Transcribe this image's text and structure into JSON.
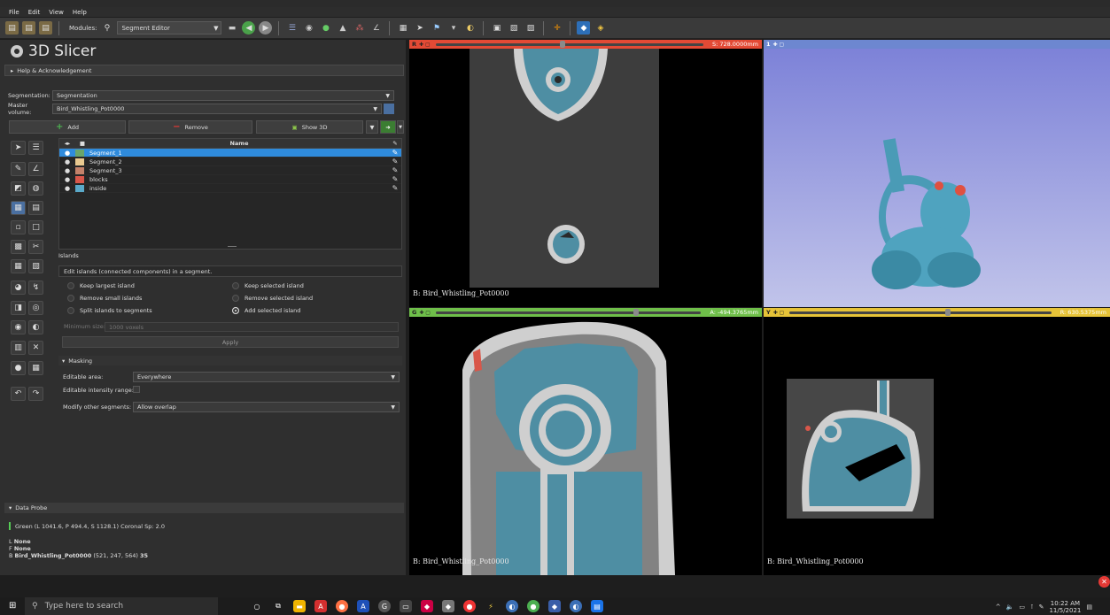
{
  "menu": [
    "File",
    "Edit",
    "View",
    "Help"
  ],
  "toolbar": {
    "modules_label": "Modules:",
    "module_selected": "Segment Editor"
  },
  "app": {
    "name": "3D Slicer"
  },
  "help_section": "Help & Acknowledgement",
  "segmentation": {
    "label": "Segmentation:",
    "value": "Segmentation",
    "master_label": "Master volume:",
    "master_value": "Bird_Whistling_Pot0000"
  },
  "buttons": {
    "add": "Add",
    "remove": "Remove",
    "show3d": "Show 3D"
  },
  "table": {
    "col_name": "Name",
    "rows": [
      {
        "name": "Segment_1",
        "color": "#6aa56a",
        "selected": true
      },
      {
        "name": "Segment_2",
        "color": "#e9c98f",
        "selected": false
      },
      {
        "name": "Segment_3",
        "color": "#c4826a",
        "selected": false
      },
      {
        "name": "blocks",
        "color": "#d9574a",
        "selected": false
      },
      {
        "name": "inside",
        "color": "#5aa9c9",
        "selected": false
      }
    ]
  },
  "effect": {
    "title": "Islands",
    "description": "Edit islands (connected components) in a segment.",
    "options": [
      "Keep largest island",
      "Keep selected island",
      "Remove small islands",
      "Remove selected island",
      "Split islands to segments",
      "Add selected island"
    ],
    "min_size_label": "Minimum size:",
    "min_size_value": "1000 voxels",
    "apply": "Apply"
  },
  "masking": {
    "title": "Masking",
    "editable_area_label": "Editable area:",
    "editable_area_value": "Everywhere",
    "intensity_label": "Editable intensity range:",
    "modify_label": "Modify other segments:",
    "modify_value": "Allow overlap"
  },
  "data_probe": {
    "title": "Data Probe",
    "line1": "Green  (L 1041.6, P 494.4, S 1128.1)  Coronal Sp: 2.0",
    "l_label": "L",
    "l_value": "None",
    "f_label": "F",
    "f_value": "None",
    "b_label": "B",
    "b_name": "Bird_Whistling_Pot0000",
    "b_coords": "(521, 247, 564)",
    "b_value": "35"
  },
  "views": {
    "red": {
      "badge": "R",
      "value": "S: 728.0000mm",
      "label": "B: Bird_Whistling_Pot0000"
    },
    "threed": {
      "badge": "1"
    },
    "green": {
      "badge": "G",
      "value": "A: -494.3765mm",
      "label": "B: Bird_Whistling_Pot0000"
    },
    "yellow": {
      "badge": "Y",
      "value": "R: 630.5375mm",
      "label": "B: Bird_Whistling_Pot0000"
    }
  },
  "taskbar": {
    "search_placeholder": "Type here to search",
    "time": "10:22 AM",
    "date": "11/5/2021"
  }
}
